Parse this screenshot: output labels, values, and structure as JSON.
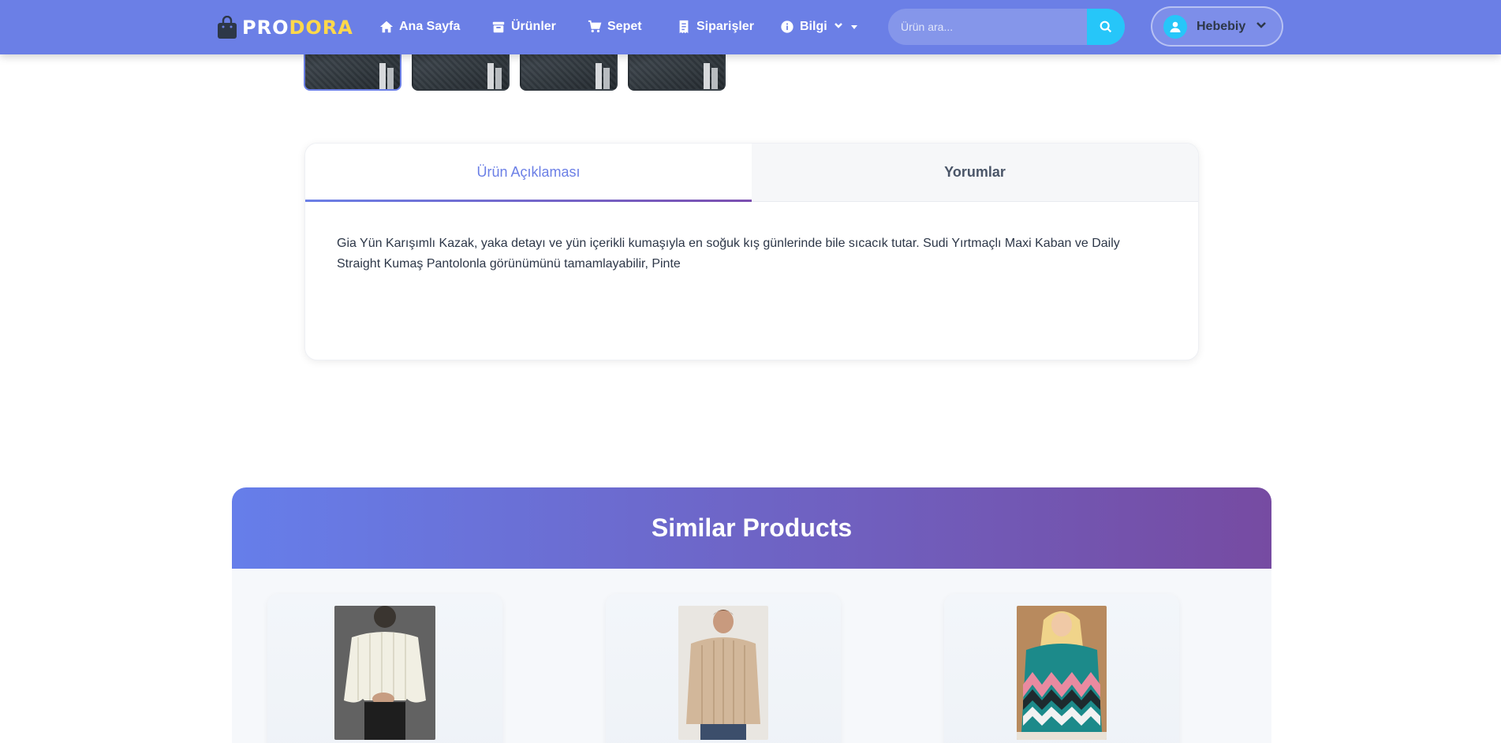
{
  "navbar": {
    "brand_part1": "PRO",
    "brand_part2": "DORA",
    "brand_icon": "shopping-bag-icon",
    "links": [
      {
        "label": "Ana Sayfa",
        "icon": "home-icon"
      },
      {
        "label": "Ürünler",
        "icon": "box-icon"
      },
      {
        "label": "Sepet",
        "icon": "cart-icon"
      },
      {
        "label": "Siparişler",
        "icon": "receipt-icon"
      },
      {
        "label": "Bilgi",
        "icon": "info-icon"
      }
    ],
    "search_placeholder": "Ürün ara...",
    "user_name": "Hebebiy"
  },
  "colors": {
    "navbar": "#6b7fe6",
    "brand_accent": "#ffd84a",
    "search_button": "#26c6f9",
    "tab_active": "#6b7fe6",
    "gradient_start": "#667eea",
    "gradient_end": "#764ba2"
  },
  "tabs": [
    {
      "label": "Ürün Açıklaması",
      "active": true
    },
    {
      "label": "Yorumlar",
      "active": false
    }
  ],
  "description": "Gia Yün Karışımlı Kazak, yaka detayı ve yün içerikli kumaşıyla en soğuk kış günlerinde bile sıcacık tutar. Sudi Yırtmaçlı Maxi Kaban ve Daily Straight Kumaş Pantolonla görünümünü tamamlayabilir, Pinte",
  "similar": {
    "title": "Similar Products"
  }
}
